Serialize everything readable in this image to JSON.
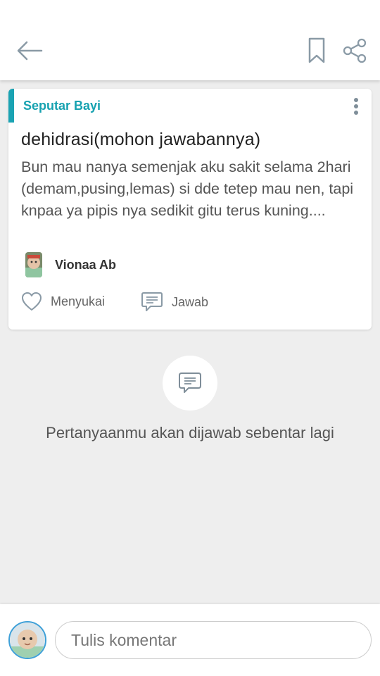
{
  "header": {
    "back_icon": "arrow-left-icon",
    "bookmark_icon": "bookmark-icon",
    "share_icon": "share-icon"
  },
  "post": {
    "category": "Seputar Bayi",
    "title": "dehidrasi(mohon jawabannya)",
    "body": "Bun mau nanya semenjak aku sakit selama 2hari (demam,pusing,lemas) si dde tetep mau nen, tapi knpaa ya pipis nya sedikit gitu terus kuning....",
    "author": "Vionaa Ab",
    "like_label": "Menyukai",
    "reply_label": "Jawab",
    "accent_color": "#1aa3b3"
  },
  "empty_state": {
    "icon": "chat-bubble-icon",
    "message": "Pertanyaanmu akan dijawab sebentar lagi"
  },
  "comment_bar": {
    "placeholder": "Tulis komentar"
  }
}
